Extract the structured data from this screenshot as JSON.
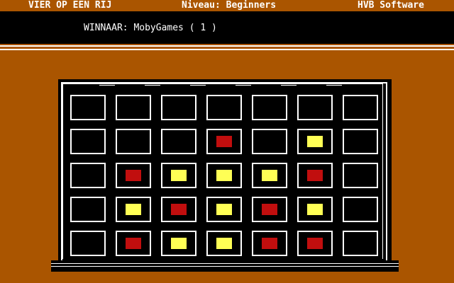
{
  "header": {
    "game_title": "VIER OP EEN RIJ",
    "level": "Niveau: Beginners",
    "publisher": "HVB Software"
  },
  "status": {
    "winner_text": "WINNAAR: MobyGames ( 1 )"
  },
  "board": {
    "columns": 7,
    "rows": 5,
    "top_dots": "....",
    "grid": [
      [
        "empty",
        "empty",
        "empty",
        "empty",
        "empty",
        "empty",
        "empty"
      ],
      [
        "empty",
        "empty",
        "empty",
        "red",
        "empty",
        "yellow",
        "empty"
      ],
      [
        "empty",
        "red",
        "yellow",
        "yellow",
        "yellow",
        "red",
        "empty"
      ],
      [
        "empty",
        "yellow",
        "red",
        "yellow",
        "red",
        "yellow",
        "empty"
      ],
      [
        "empty",
        "red",
        "yellow",
        "yellow",
        "red",
        "red",
        "empty"
      ]
    ]
  },
  "colors": {
    "background": "#aa5500",
    "yellow_disc": "#ffff55",
    "red_disc": "#aa0000"
  }
}
